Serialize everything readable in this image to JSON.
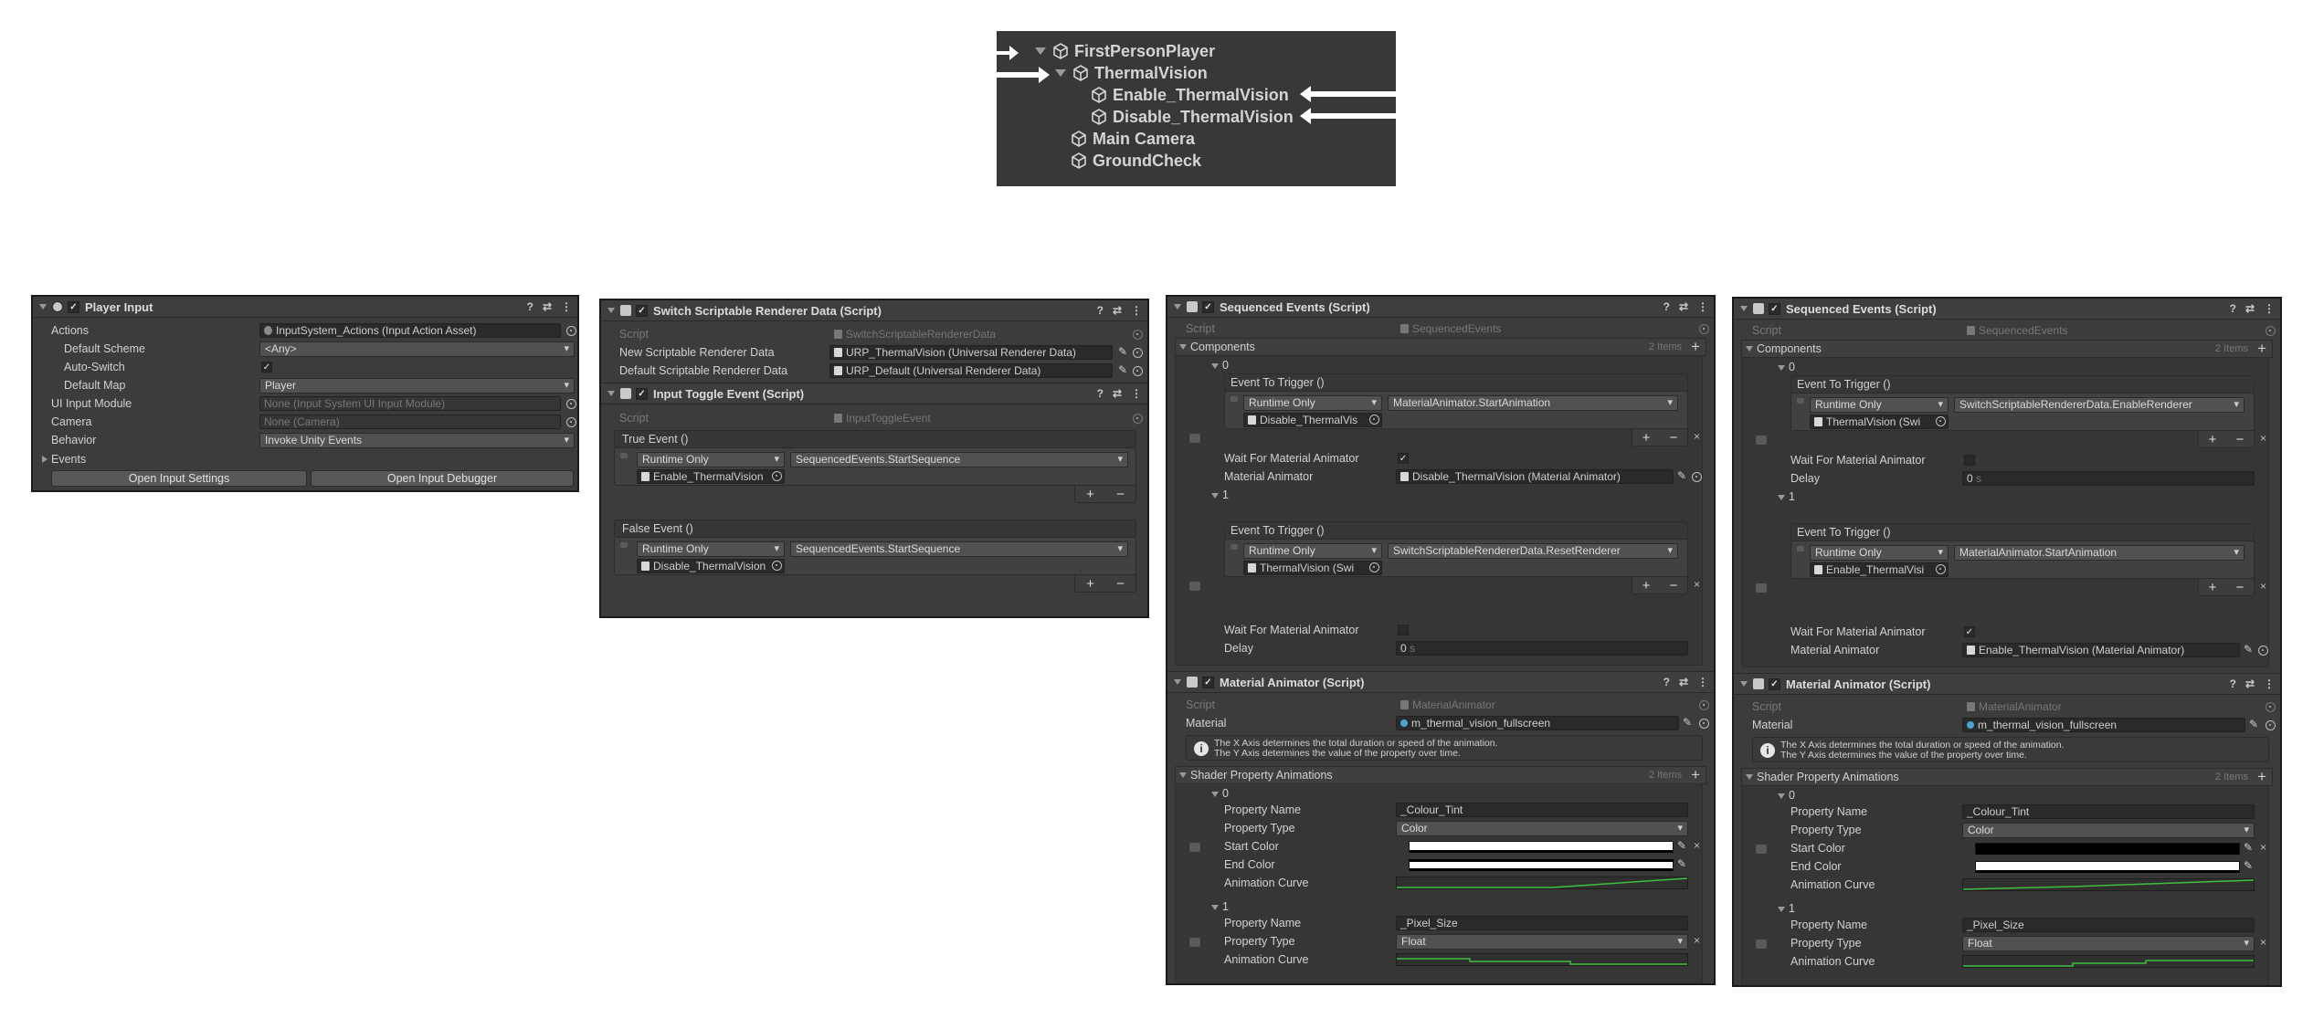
{
  "hierarchy": {
    "items": [
      "FirstPersonPlayer",
      "ThermalVision",
      "Enable_ThermalVision",
      "Disable_ThermalVision",
      "Main Camera",
      "GroundCheck"
    ]
  },
  "player_input": {
    "title": "Player Input",
    "rows": {
      "actions_label": "Actions",
      "actions_value": "InputSystem_Actions (Input Action Asset)",
      "default_scheme_label": "Default Scheme",
      "default_scheme_value": "<Any>",
      "auto_switch_label": "Auto-Switch",
      "default_map_label": "Default Map",
      "default_map_value": "Player",
      "ui_input_label": "UI Input Module",
      "ui_input_value": "None (Input System UI Input Module)",
      "camera_label": "Camera",
      "camera_value": "None (Camera)",
      "behavior_label": "Behavior",
      "behavior_value": "Invoke Unity Events",
      "events_label": "Events"
    },
    "buttons": {
      "open_settings": "Open Input Settings",
      "open_debugger": "Open Input Debugger"
    }
  },
  "switch_renderer": {
    "title": "Switch Scriptable Renderer Data (Script)",
    "script_label": "Script",
    "script_value": "SwitchScriptableRendererData",
    "new_label": "New Scriptable Renderer Data",
    "new_value": "URP_ThermalVision (Universal Renderer Data)",
    "default_label": "Default Scriptable Renderer Data",
    "default_value": "URP_Default (Universal Renderer Data)"
  },
  "input_toggle": {
    "title": "Input Toggle Event (Script)",
    "script_label": "Script",
    "script_value": "InputToggleEvent",
    "true_event": "True Event ()",
    "false_event": "False Event ()",
    "runtime": "Runtime Only",
    "true_func": "SequencedEvents.StartSequence",
    "true_obj": "Enable_ThermalVision",
    "false_func": "SequencedEvents.StartSequence",
    "false_obj": "Disable_ThermalVision",
    "plus": "+",
    "minus": "−"
  },
  "seq_a": {
    "title": "Sequenced Events (Script)",
    "script_label": "Script",
    "script_value": "SequencedEvents",
    "components": "Components",
    "count": "2 Items",
    "idx0": "0",
    "idx1": "1",
    "event_label": "Event To Trigger ()",
    "runtime": "Runtime Only",
    "e0_func": "MaterialAnimator.StartAnimation",
    "e0_obj": "Disable_ThermalVis",
    "wait_label": "Wait For Material Animator",
    "mat_anim_label": "Material Animator",
    "mat_anim_value": "Disable_ThermalVision (Material Animator)",
    "e1_func": "SwitchScriptableRendererData.ResetRenderer",
    "e1_obj": "ThermalVision (Swi",
    "delay_label": "Delay",
    "delay_value": "0",
    "plus": "+",
    "minus": "−",
    "x": "×"
  },
  "seq_b": {
    "title": "Sequenced Events (Script)",
    "script_label": "Script",
    "script_value": "SequencedEvents",
    "components": "Components",
    "count": "2 Items",
    "idx0": "0",
    "idx1": "1",
    "event_label": "Event To Trigger ()",
    "runtime": "Runtime Only",
    "e0_func": "SwitchScriptableRendererData.EnableRenderer",
    "e0_obj": "ThermalVision (Swi",
    "wait_label": "Wait For Material Animator",
    "delay_label": "Delay",
    "delay_value": "0",
    "e1_func": "MaterialAnimator.StartAnimation",
    "e1_obj": "Enable_ThermalVisi",
    "mat_anim_label": "Material Animator",
    "mat_anim_value": "Enable_ThermalVision (Material Animator)",
    "plus": "+",
    "minus": "−",
    "x": "×"
  },
  "mat_anim": {
    "title": "Material Animator (Script)",
    "script_label": "Script",
    "script_value": "MaterialAnimator",
    "material_label": "Material",
    "material_value": "m_thermal_vision_fullscreen",
    "info_line1": "The X Axis determines the total duration or speed of the animation.",
    "info_line2": "The Y Axis determines the value of the property over time.",
    "shader_label": "Shader Property Animations",
    "count": "2 Items",
    "idx0": "0",
    "idx1": "1",
    "prop_name_label": "Property Name",
    "prop_type_label": "Property Type",
    "start_color_label": "Start Color",
    "end_color_label": "End Color",
    "curve_label": "Animation Curve",
    "p0_name": "_Colour_Tint",
    "p0_type": "Color",
    "p1_name": "_Pixel_Size",
    "p1_type": "Float",
    "x": "×"
  },
  "colors": {
    "panel_bg": "#3c3c3c",
    "field_bg": "#2a2a2a",
    "curve_green": "#3fbf3f"
  }
}
